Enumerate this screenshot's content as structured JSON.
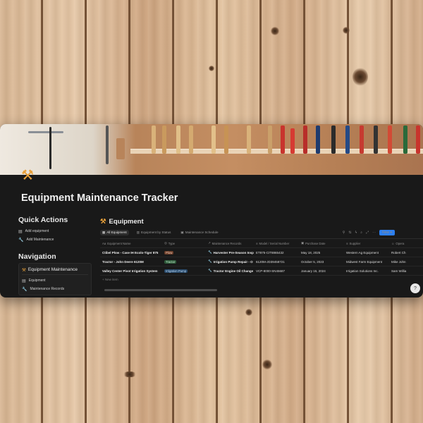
{
  "page": {
    "title": "Equipment Maintenance Tracker",
    "icon": "hammer-icon"
  },
  "sidebar": {
    "quick_actions_title": "Quick Actions",
    "quick_actions": [
      {
        "label": "Add equipment",
        "icon": "document-icon"
      },
      {
        "label": "Add Maintenance",
        "icon": "wrench-icon"
      }
    ],
    "navigation_title": "Navigation",
    "nav_card_title": "Equipment Maintenance",
    "nav_items": [
      {
        "label": "Equipment",
        "icon": "document-icon"
      },
      {
        "label": "Maintenance Records",
        "icon": "wrench-icon"
      }
    ]
  },
  "database": {
    "title": "Equipment",
    "views": [
      {
        "label": "All Equipment",
        "active": true
      },
      {
        "label": "Equipment by Status",
        "active": false
      },
      {
        "label": "Maintenance Schedule",
        "active": false
      }
    ],
    "new_button": "New",
    "columns": [
      "Equipment Name",
      "Type",
      "Maintenance Records",
      "Model / Serial Number",
      "Purchase Date",
      "Supplier",
      "Opera"
    ],
    "rows": [
      {
        "name": "Ctibel Plow - Case IH Ecolo-Tiger 875",
        "type": "Plow",
        "type_color": "#6b3e2a",
        "type_text_color": "#f0c9b6",
        "record": "Harvester Pre-Season Insp",
        "serial": "ET875-CIT8865432",
        "date": "May 18, 2025",
        "supplier": "Western Ag Equipment",
        "operator": "Robert Ch"
      },
      {
        "name": "Tractor - John Deere 6120M",
        "type": "Tractor",
        "type_color": "#2e5a3a",
        "type_text_color": "#bfe3c9",
        "record": "Irrigation Pump Repair - O",
        "serial": "6120M-JD39458721",
        "date": "October 5, 2023",
        "supplier": "Midwest Farm Equipment",
        "operator": "Mike John"
      },
      {
        "name": "Valley Center Pivot Irrigation System",
        "type": "Irrigation Pump",
        "type_color": "#284a6b",
        "type_text_color": "#bcd6f0",
        "record": "Tractor Engine Oil Change",
        "serial": "VCP-8000-SN45687",
        "date": "January 15, 2024",
        "supplier": "Irrigation Solutions Inc.",
        "operator": "Sam Willia"
      }
    ],
    "new_item_label": "+ New item"
  },
  "colors": {
    "accent": "#2d7ff0",
    "background": "#191919"
  }
}
